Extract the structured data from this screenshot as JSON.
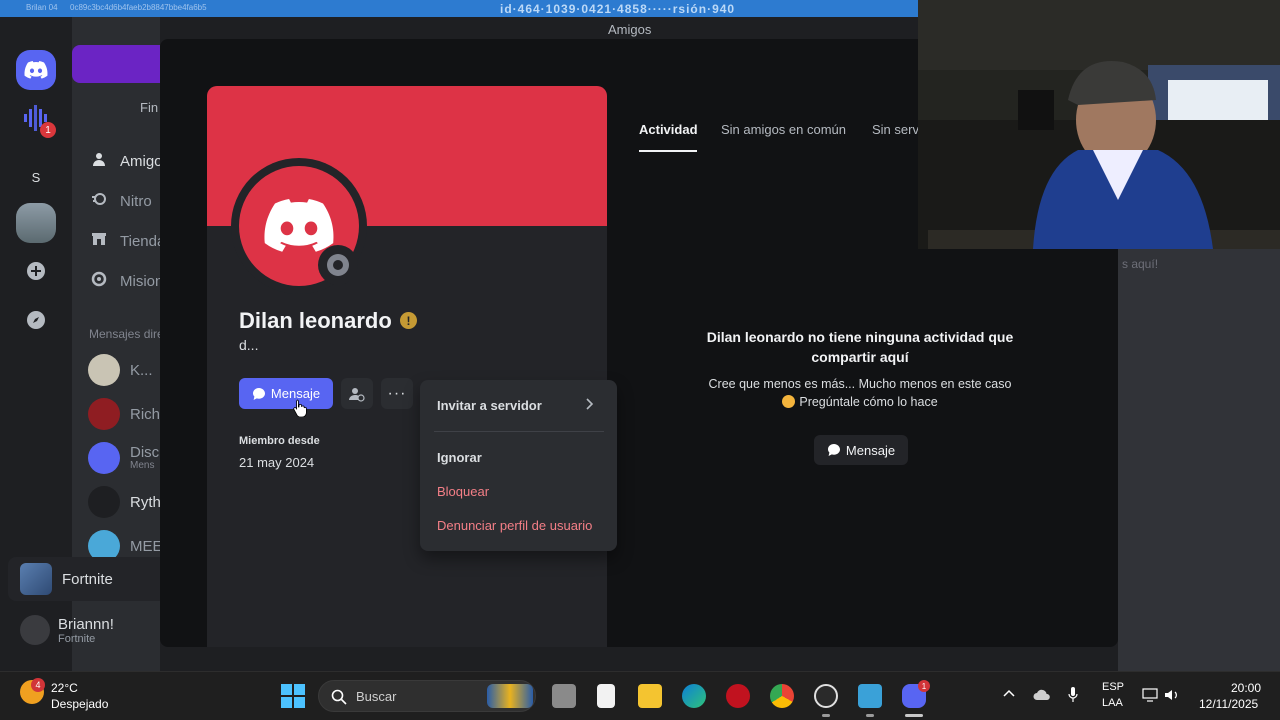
{
  "topstrip": {
    "left_text": "Brilan 04",
    "hash_text": "0c89c3bc4d6b4faeb2b8847bbe4fa6b5",
    "blurred_text": "id·464·1039·0421·4858·····rsión·940"
  },
  "window": {
    "title": "Amigos"
  },
  "sidebar": {
    "find_label": "Fin",
    "nav": [
      {
        "label": "Amigos",
        "icon": "friends-icon"
      },
      {
        "label": "Nitro",
        "icon": "nitro-icon"
      },
      {
        "label": "Tienda",
        "icon": "shop-icon"
      },
      {
        "label": "Misiones",
        "icon": "quests-icon"
      }
    ],
    "dm_header": "Mensajes directos",
    "dms": [
      {
        "name": "K...",
        "sub": ""
      },
      {
        "name": "Rich",
        "sub": ""
      },
      {
        "name": "Disc",
        "sub": "Mens"
      },
      {
        "name": "Ryth",
        "sub": ""
      },
      {
        "name": "MEE",
        "sub": ""
      }
    ],
    "activity_bar": "Fortnite",
    "user": {
      "name": "Briannn!",
      "status": "Fortnite"
    },
    "rail_letter": "S",
    "rail_badge": "1"
  },
  "profile": {
    "display_name": "Dilan leonardo",
    "handle": "d...",
    "badge_symbol": "!",
    "message_button": "Mensaje",
    "member_since_label": "Miembro desde",
    "member_since_date": "21 may 2024",
    "banner_color": "#dd3346"
  },
  "context_menu": {
    "invite": "Invitar a servidor",
    "ignore": "Ignorar",
    "block": "Bloquear",
    "report": "Denunciar perfil de usuario"
  },
  "tabs": [
    {
      "label": "Actividad",
      "active": true
    },
    {
      "label": "Sin amigos en común",
      "active": false
    },
    {
      "label": "Sin servidores en común",
      "active": false
    }
  ],
  "activity": {
    "title": "Dilan leonardo no tiene ninguna actividad que compartir aquí",
    "subtitle_line1": "Cree que menos es más... Mucho menos en este caso",
    "subtitle_line2": "Pregúntale cómo lo hace",
    "button": "Mensaje"
  },
  "background_text": "s aquí!",
  "taskbar": {
    "weather_badge": "4",
    "temperature": "22°C",
    "weather": "Despejado",
    "search_label": "Buscar",
    "discord_badge": "1",
    "lang1": "ESP",
    "lang2": "LAA",
    "time": "20:00",
    "date": "12/11/2025"
  }
}
